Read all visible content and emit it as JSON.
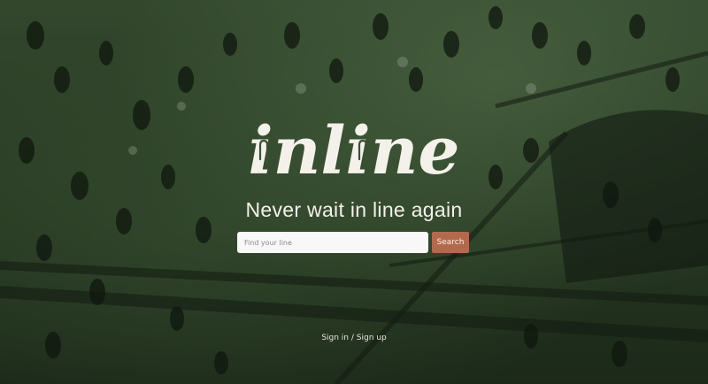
{
  "brand": {
    "logo_text": "inline"
  },
  "hero": {
    "tagline": "Never wait in line again"
  },
  "search": {
    "placeholder": "Find your line",
    "value": "",
    "button_label": "Search"
  },
  "auth": {
    "link_label": "Sign in / Sign up"
  },
  "colors": {
    "accent": "#b26a4c",
    "text": "#f4f1ea",
    "background": "#2f4529"
  }
}
